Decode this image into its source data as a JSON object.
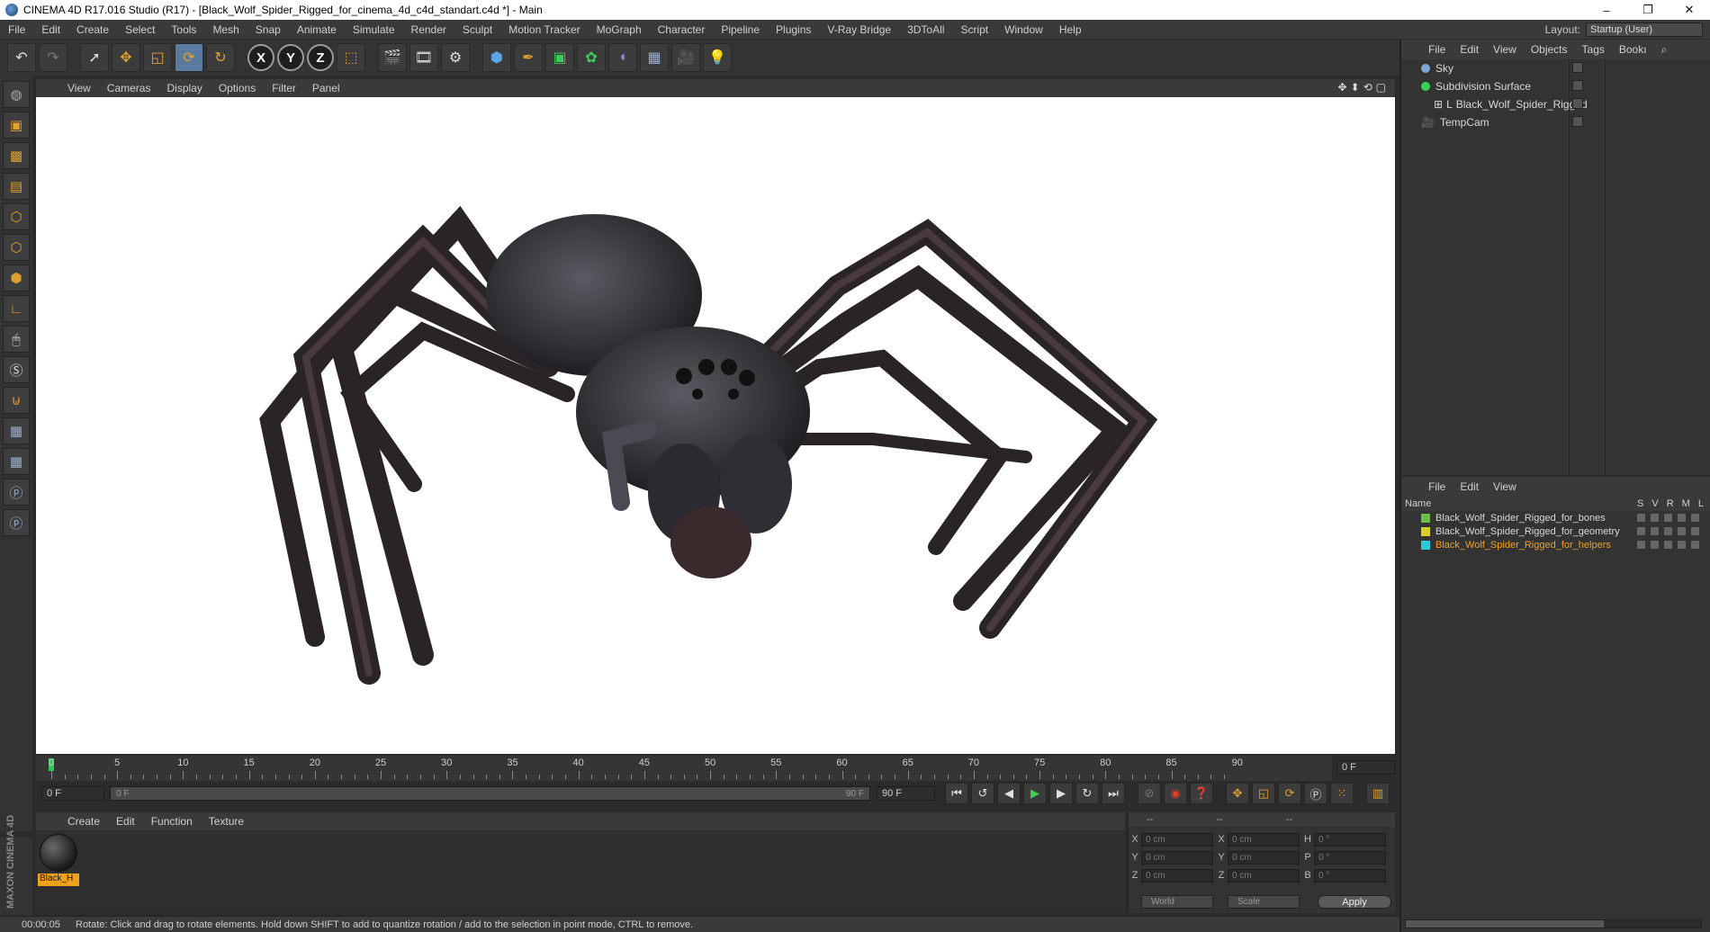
{
  "window": {
    "title": "CINEMA 4D R17.016 Studio (R17) - [Black_Wolf_Spider_Rigged_for_cinema_4d_c4d_standart.c4d *] - Main",
    "min": "–",
    "max": "❐",
    "close": "✕"
  },
  "menu": [
    "File",
    "Edit",
    "Create",
    "Select",
    "Tools",
    "Mesh",
    "Snap",
    "Animate",
    "Simulate",
    "Render",
    "Sculpt",
    "Motion Tracker",
    "MoGraph",
    "Character",
    "Pipeline",
    "Plugins",
    "V-Ray Bridge",
    "3DToAll",
    "Script",
    "Window",
    "Help"
  ],
  "layout": {
    "label": "Layout:",
    "value": "Startup (User)"
  },
  "viewport_menu": [
    "View",
    "Cameras",
    "Display",
    "Options",
    "Filter",
    "Panel"
  ],
  "viewport_nav": [
    "✥",
    "⬍",
    "⟲",
    "▢"
  ],
  "timeline": {
    "ticks": [
      "0",
      "5",
      "10",
      "15",
      "20",
      "25",
      "30",
      "35",
      "40",
      "45",
      "50",
      "55",
      "60",
      "65",
      "70",
      "75",
      "80",
      "85",
      "90"
    ],
    "current_frame": "0 F",
    "start_frame": "0 F",
    "range_start": "0 F",
    "range_end": "90 F",
    "end_frame": "90 F"
  },
  "material_menu": [
    "Create",
    "Edit",
    "Function",
    "Texture"
  ],
  "material": {
    "name": "Black_H"
  },
  "coords": {
    "head": [
      "--",
      "--",
      "--"
    ],
    "rows": [
      {
        "a": "X",
        "v1": "0 cm",
        "b": "X",
        "v2": "0 cm",
        "c": "H",
        "v3": "0 °"
      },
      {
        "a": "Y",
        "v1": "0 cm",
        "b": "Y",
        "v2": "0 cm",
        "c": "P",
        "v3": "0 °"
      },
      {
        "a": "Z",
        "v1": "0 cm",
        "b": "Z",
        "v2": "0 cm",
        "c": "B",
        "v3": "0 °"
      }
    ],
    "world": "World",
    "scale": "Scale",
    "apply": "Apply"
  },
  "status": {
    "time": "00:00:05",
    "message": "Rotate: Click and drag to rotate elements. Hold down SHIFT to add to quantize rotation / add to the selection in point mode, CTRL to remove."
  },
  "objects_menu": [
    "File",
    "Edit",
    "View",
    "Objects",
    "Tags",
    "Bookı"
  ],
  "objects": [
    {
      "name": "Sky",
      "color": "#7fa7d6",
      "indent": 0
    },
    {
      "name": "Subdivision Surface",
      "color": "#3bcf5a",
      "indent": 0
    },
    {
      "name": "Black_Wolf_Spider_Rigged",
      "color": "#bbbbbb",
      "indent": 1
    },
    {
      "name": "TempCam",
      "color": "#bbbbbb",
      "indent": 0
    }
  ],
  "layers_menu": [
    "File",
    "Edit",
    "View"
  ],
  "layers_header": {
    "name": "Name",
    "cols": [
      "S",
      "V",
      "R",
      "M",
      "L"
    ]
  },
  "layers": [
    {
      "name": "Black_Wolf_Spider_Rigged_for_bones",
      "color": "#6bbf4b",
      "text_color": "#d8d8d8"
    },
    {
      "name": "Black_Wolf_Spider_Rigged_for_geometry",
      "color": "#d8cc2a",
      "text_color": "#d8d8d8"
    },
    {
      "name": "Black_Wolf_Spider_Rigged_for_helpers",
      "color": "#2ac8d8",
      "text_color": "#f2a11a"
    }
  ]
}
